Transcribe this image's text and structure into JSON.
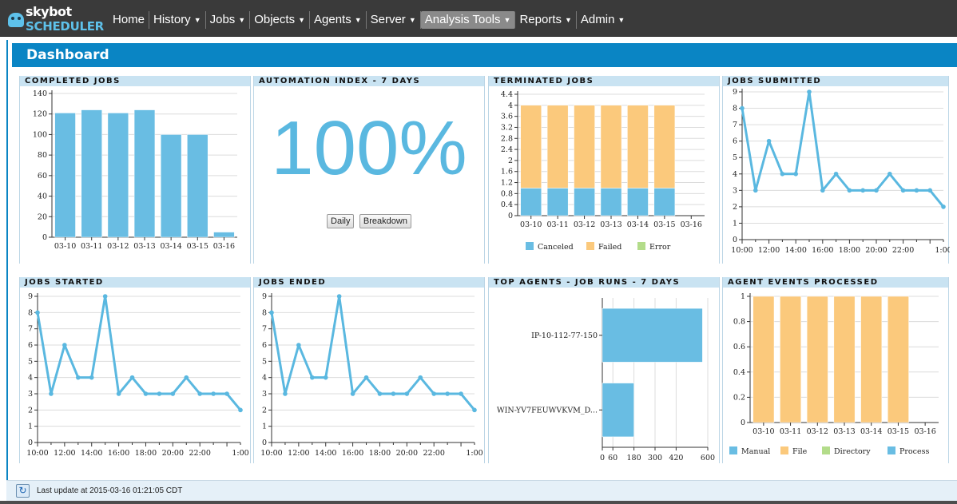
{
  "logo": {
    "top": "skybot",
    "bottom": "SCHEDULER"
  },
  "nav": [
    {
      "label": "Home",
      "caret": false,
      "active": false
    },
    {
      "label": "History",
      "caret": true,
      "active": false
    },
    {
      "label": "Jobs",
      "caret": true,
      "active": false
    },
    {
      "label": "Objects",
      "caret": true,
      "active": false
    },
    {
      "label": "Agents",
      "caret": true,
      "active": false
    },
    {
      "label": "Server",
      "caret": true,
      "active": false
    },
    {
      "label": "Analysis Tools",
      "caret": true,
      "active": true
    },
    {
      "label": "Reports",
      "caret": true,
      "active": false
    },
    {
      "label": "Admin",
      "caret": true,
      "active": false
    }
  ],
  "dashboard": {
    "title": "Dashboard"
  },
  "panels": {
    "completed": "COMPLETED JOBS",
    "automation": "AUTOMATION INDEX - 7 DAYS",
    "terminated": "TERMINATED JOBS",
    "submitted": "JOBS SUBMITTED",
    "started": "JOBS STARTED",
    "ended": "JOBS ENDED",
    "agents": "TOP AGENTS - JOB RUNS - 7 DAYS",
    "events": "AGENT EVENTS PROCESSED"
  },
  "automation": {
    "value": "100%",
    "daily_label": "Daily",
    "breakdown_label": "Breakdown"
  },
  "status": {
    "text": "Last update at 2015-03-16 01:21:05 CDT"
  },
  "colors": {
    "blue": "#69bde3",
    "orange": "#fbc97c",
    "green": "#b3dc8a",
    "line": "#5ab8e0"
  },
  "chart_data": [
    {
      "id": "completed",
      "type": "bar",
      "categories": [
        "03-10",
        "03-11",
        "03-12",
        "03-13",
        "03-14",
        "03-15",
        "03-16"
      ],
      "values": [
        121,
        124,
        121,
        124,
        100,
        100,
        5
      ],
      "ylim": [
        0,
        140
      ],
      "yticks": [
        0,
        20,
        40,
        60,
        80,
        100,
        120,
        140
      ]
    },
    {
      "id": "terminated",
      "type": "bar",
      "stacked": true,
      "categories": [
        "03-10",
        "03-11",
        "03-12",
        "03-13",
        "03-14",
        "03-15",
        "03-16"
      ],
      "series": [
        {
          "name": "Canceled",
          "values": [
            1,
            1,
            1,
            1,
            1,
            1,
            0
          ]
        },
        {
          "name": "Failed",
          "values": [
            3,
            3,
            3,
            3,
            3,
            3,
            0
          ]
        },
        {
          "name": "Error",
          "values": [
            0,
            0,
            0,
            0,
            0,
            0,
            0
          ]
        }
      ],
      "ylim": [
        0,
        4.4
      ],
      "yticks": [
        "0",
        "0.4",
        "0.8",
        "1.2",
        "1.6",
        "2",
        "2.4",
        "2.8",
        "3.2",
        "3.6",
        "4",
        "4.4"
      ],
      "legend": "bottom"
    },
    {
      "id": "submitted",
      "type": "line",
      "values": [
        8,
        3,
        6,
        4,
        4,
        9,
        3,
        4,
        3,
        3,
        3,
        4,
        3,
        3,
        3,
        2
      ],
      "ylim": [
        0,
        9
      ],
      "yticks": [
        0,
        1,
        2,
        3,
        4,
        5,
        6,
        7,
        8,
        9
      ],
      "xticks": [
        "10:00",
        "12:00",
        "14:00",
        "16:00",
        "18:00",
        "20:00",
        "22:00",
        "1:00"
      ]
    },
    {
      "id": "started",
      "type": "line",
      "values": [
        8,
        3,
        6,
        4,
        4,
        9,
        3,
        4,
        3,
        3,
        3,
        4,
        3,
        3,
        3,
        2
      ],
      "ylim": [
        0,
        9
      ],
      "yticks": [
        0,
        1,
        2,
        3,
        4,
        5,
        6,
        7,
        8,
        9
      ],
      "xticks": [
        "10:00",
        "12:00",
        "14:00",
        "16:00",
        "18:00",
        "20:00",
        "22:00",
        "1:00"
      ]
    },
    {
      "id": "ended",
      "type": "line",
      "values": [
        8,
        3,
        6,
        4,
        4,
        9,
        3,
        4,
        3,
        3,
        3,
        4,
        3,
        3,
        3,
        2
      ],
      "ylim": [
        0,
        9
      ],
      "yticks": [
        0,
        1,
        2,
        3,
        4,
        5,
        6,
        7,
        8,
        9
      ],
      "xticks": [
        "10:00",
        "12:00",
        "14:00",
        "16:00",
        "18:00",
        "20:00",
        "22:00",
        "1:00"
      ]
    },
    {
      "id": "agents",
      "type": "bar",
      "orientation": "horizontal",
      "categories": [
        "IP-10-112-77-150",
        "WIN-YV7FEUWVKVM_D..."
      ],
      "values": [
        570,
        180
      ],
      "xlim": [
        0,
        600
      ],
      "xticks": [
        0,
        60,
        180,
        300,
        420,
        600
      ]
    },
    {
      "id": "events",
      "type": "bar",
      "stacked": true,
      "categories": [
        "03-10",
        "03-11",
        "03-12",
        "03-13",
        "03-14",
        "03-15",
        "03-16"
      ],
      "series": [
        {
          "name": "Manual",
          "values": [
            0,
            0,
            0,
            0,
            0,
            0,
            0
          ]
        },
        {
          "name": "File",
          "values": [
            1,
            1,
            1,
            1,
            1,
            1,
            0
          ]
        },
        {
          "name": "Directory",
          "values": [
            0,
            0,
            0,
            0,
            0,
            0,
            0
          ]
        },
        {
          "name": "Process",
          "values": [
            0,
            0,
            0,
            0,
            0,
            0,
            0
          ]
        }
      ],
      "ylim": [
        0,
        1
      ],
      "yticks": [
        "0",
        "0.2",
        "0.4",
        "0.6",
        "0.8",
        "1"
      ],
      "legend": "bottom"
    }
  ]
}
